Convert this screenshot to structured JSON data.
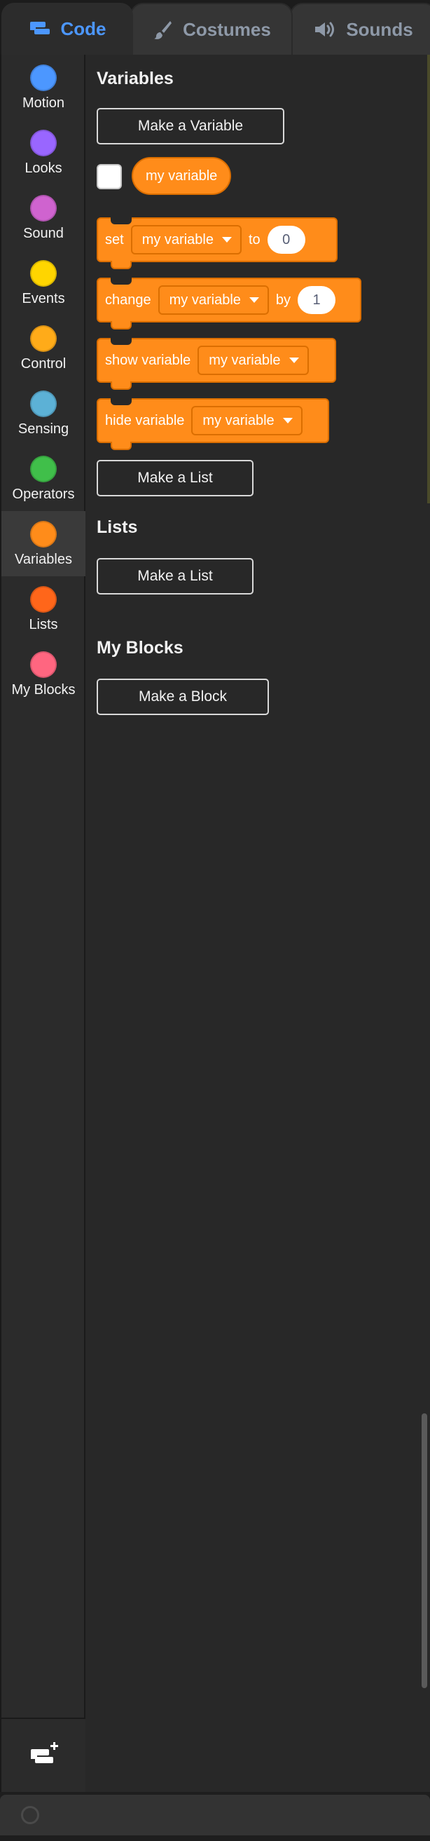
{
  "tabs": [
    {
      "label": "Code",
      "icon": "code-icon",
      "selected": true
    },
    {
      "label": "Costumes",
      "icon": "brush-icon",
      "selected": false
    },
    {
      "label": "Sounds",
      "icon": "speaker-icon",
      "selected": false
    }
  ],
  "categories": [
    {
      "label": "Motion",
      "color": "#4c97ff"
    },
    {
      "label": "Looks",
      "color": "#9966ff"
    },
    {
      "label": "Sound",
      "color": "#cf63cf"
    },
    {
      "label": "Events",
      "color": "#ffd500"
    },
    {
      "label": "Control",
      "color": "#ffab19"
    },
    {
      "label": "Sensing",
      "color": "#5cb1d6"
    },
    {
      "label": "Operators",
      "color": "#40bf4a"
    },
    {
      "label": "Variables",
      "color": "#ff8c1a",
      "selected": true
    },
    {
      "label": "Lists",
      "color": "#ff661a"
    },
    {
      "label": "My Blocks",
      "color": "#ff6680"
    }
  ],
  "palette": {
    "variables_heading": "Variables",
    "make_variable": "Make a Variable",
    "variable_reporter": "my variable",
    "blocks": {
      "set": {
        "label": "set",
        "var": "my variable",
        "mid": "to",
        "value": "0"
      },
      "change": {
        "label": "change",
        "var": "my variable",
        "mid": "by",
        "value": "1"
      },
      "show": {
        "label": "show variable",
        "var": "my variable"
      },
      "hide": {
        "label": "hide variable",
        "var": "my variable"
      }
    },
    "make_list_1": "Make a List",
    "lists_heading": "Lists",
    "make_list_2": "Make a List",
    "myblocks_heading": "My Blocks",
    "make_block": "Make a Block"
  },
  "colors": {
    "accent": "#4c97ff",
    "variables_block": "#ff8c1a",
    "variables_block_border": "#db6e00"
  }
}
